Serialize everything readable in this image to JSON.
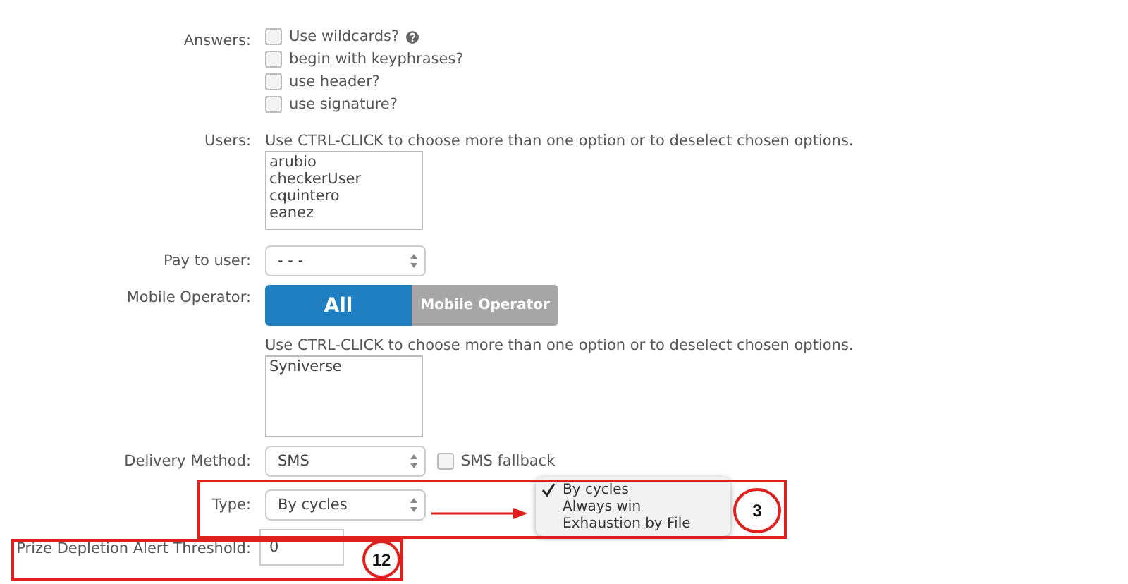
{
  "answers": {
    "label": "Answers:",
    "options": [
      {
        "label": "Use wildcards?",
        "checked": false,
        "help": true
      },
      {
        "label": "begin with keyphrases?",
        "checked": false,
        "help": false
      },
      {
        "label": "use header?",
        "checked": false,
        "help": false
      },
      {
        "label": "use signature?",
        "checked": false,
        "help": false
      }
    ]
  },
  "users": {
    "label": "Users:",
    "hint": "Use CTRL-CLICK to choose more than one option or to deselect chosen options.",
    "options": [
      "arubio",
      "checkerUser",
      "cquintero",
      "eanez"
    ]
  },
  "pay_to_user": {
    "label": "Pay to user:",
    "value": "- - -"
  },
  "mobile_operator": {
    "label": "Mobile Operator:",
    "toggle": [
      {
        "label": "All",
        "selected": true
      },
      {
        "label": "Mobile Operator",
        "selected": false
      }
    ],
    "hint": "Use CTRL-CLICK to choose more than one option or to deselect chosen options.",
    "options": [
      "Syniverse"
    ]
  },
  "delivery_method": {
    "label": "Delivery Method:",
    "value": "SMS",
    "fallback": {
      "label": "SMS fallback",
      "checked": false
    }
  },
  "type": {
    "label": "Type:",
    "value": "By cycles",
    "menu": [
      {
        "label": "By cycles",
        "selected": true
      },
      {
        "label": "Always win",
        "selected": false
      },
      {
        "label": "Exhaustion by File",
        "selected": false
      }
    ],
    "callout": "3"
  },
  "threshold": {
    "label": "Prize Depletion Alert Threshold:",
    "value": "0",
    "callout": "12"
  }
}
